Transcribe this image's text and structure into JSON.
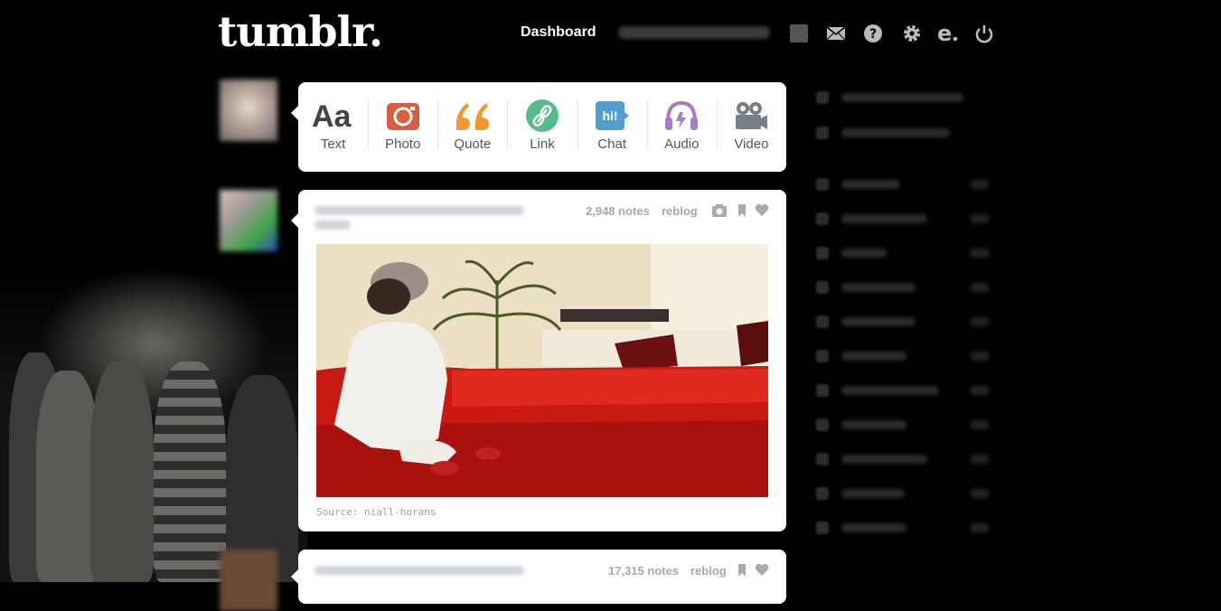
{
  "header": {
    "logo": "tumblr.",
    "nav_dashboard": "Dashboard",
    "icons": [
      "user-icon",
      "mail-icon",
      "help-icon",
      "gear-icon",
      "e-icon",
      "power-icon"
    ]
  },
  "post_types": [
    {
      "label": "Text",
      "icon": "text-icon",
      "color": "#444444"
    },
    {
      "label": "Photo",
      "icon": "camera-icon",
      "color": "#d95e40"
    },
    {
      "label": "Quote",
      "icon": "quote-icon",
      "color": "#f2992e"
    },
    {
      "label": "Link",
      "icon": "link-icon",
      "color": "#56bc8a"
    },
    {
      "label": "Chat",
      "icon": "chat-icon",
      "color": "#529ecc"
    },
    {
      "label": "Audio",
      "icon": "headphones-icon",
      "color": "#a77dc2"
    },
    {
      "label": "Video",
      "icon": "video-camera-icon",
      "color": "#748089"
    }
  ],
  "posts": [
    {
      "notes": "2,948 notes",
      "reblog": "reblog",
      "source": "Source: niall-horans"
    },
    {
      "notes": "17,315 notes",
      "reblog": "reblog"
    }
  ]
}
